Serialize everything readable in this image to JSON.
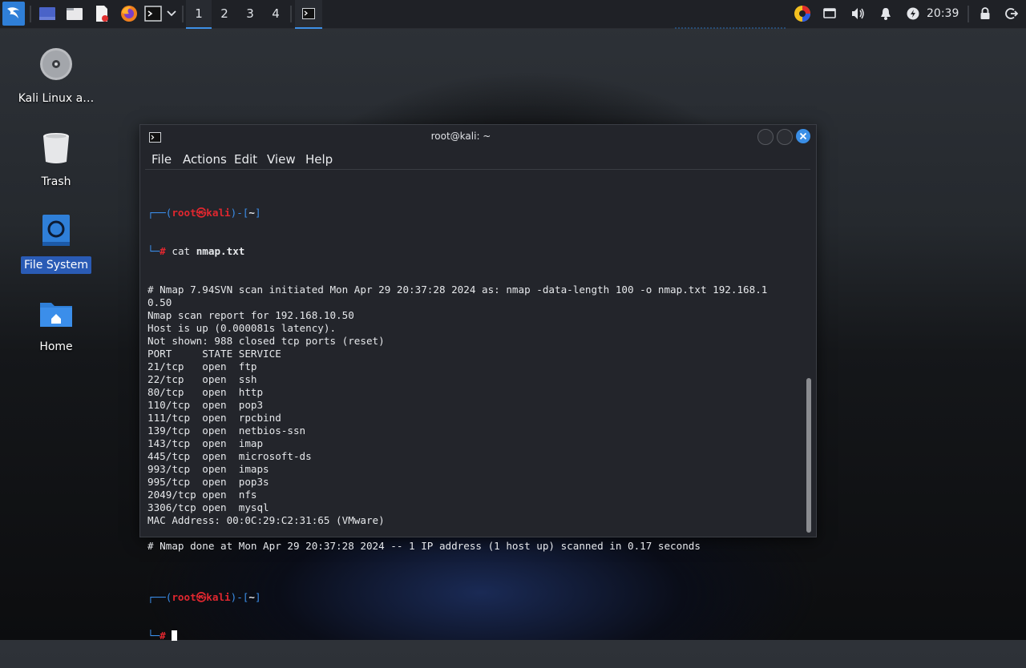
{
  "panel": {
    "workspaces": [
      "1",
      "2",
      "3",
      "4"
    ],
    "active_workspace": "1",
    "clock": "20:39",
    "icons": [
      "kali-menu-icon",
      "show-desktop-icon",
      "file-manager-icon",
      "text-editor-icon",
      "firefox-icon",
      "terminal-icon",
      "dropdown-icon",
      "terminal-task-icon",
      "color-picker-icon",
      "display-icon",
      "volume-icon",
      "notifications-icon",
      "power-manager-icon",
      "lock-icon",
      "logout-icon"
    ]
  },
  "desktop": {
    "icons": [
      {
        "label": "Kali Linux a…"
      },
      {
        "label": "Trash"
      },
      {
        "label": "File System"
      },
      {
        "label": "Home"
      }
    ]
  },
  "terminal": {
    "title": "root@kali: ~",
    "menu": [
      "File",
      "Actions",
      "Edit",
      "View",
      "Help"
    ],
    "prompt": {
      "user": "root",
      "at": "㉿",
      "host": "kali",
      "dir": "~",
      "hash": "#"
    },
    "command": "cat",
    "argument": "nmap.txt",
    "output": [
      "# Nmap 7.94SVN scan initiated Mon Apr 29 20:37:28 2024 as: nmap -data-length 100 -o nmap.txt 192.168.1",
      "0.50",
      "Nmap scan report for 192.168.10.50",
      "Host is up (0.000081s latency).",
      "Not shown: 988 closed tcp ports (reset)",
      "PORT     STATE SERVICE",
      "21/tcp   open  ftp",
      "22/tcp   open  ssh",
      "80/tcp   open  http",
      "110/tcp  open  pop3",
      "111/tcp  open  rpcbind",
      "139/tcp  open  netbios-ssn",
      "143/tcp  open  imap",
      "445/tcp  open  microsoft-ds",
      "993/tcp  open  imaps",
      "995/tcp  open  pop3s",
      "2049/tcp open  nfs",
      "3306/tcp open  mysql",
      "MAC Address: 00:0C:29:C2:31:65 (VMware)",
      "",
      "# Nmap done at Mon Apr 29 20:37:28 2024 -- 1 IP address (1 host up) scanned in 0.17 seconds",
      ""
    ]
  },
  "colors": {
    "accent": "#3d8fe6",
    "prompt_blue": "#3b8eea",
    "prompt_red": "#e0272f",
    "close_button": "#3a8ee6"
  }
}
